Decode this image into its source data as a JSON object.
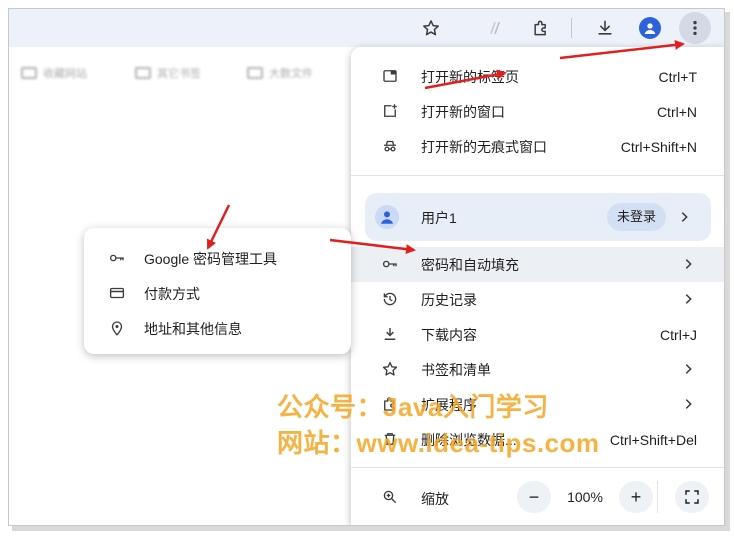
{
  "toolbar": {
    "icons": [
      "star-icon",
      "extension-a-icon",
      "puzzle-icon",
      "download-icon",
      "profile-icon",
      "more-vert-icon"
    ]
  },
  "bookmarks": {
    "items": [
      {
        "label": "收藏网站"
      },
      {
        "label": "其它书签"
      },
      {
        "label": "大数文件"
      }
    ]
  },
  "menu": {
    "new_tab": {
      "label": "打开新的标签页",
      "shortcut": "Ctrl+T"
    },
    "new_window": {
      "label": "打开新的窗口",
      "shortcut": "Ctrl+N"
    },
    "incognito": {
      "label": "打开新的无痕式窗口",
      "shortcut": "Ctrl+Shift+N"
    },
    "profile": {
      "name": "用户1",
      "status": "未登录"
    },
    "passwords": {
      "label": "密码和自动填充"
    },
    "history": {
      "label": "历史记录"
    },
    "downloads": {
      "label": "下载内容",
      "shortcut": "Ctrl+J"
    },
    "bookmarks": {
      "label": "书签和清单"
    },
    "extensions": {
      "label": "扩展程序"
    },
    "clear_data": {
      "label": "删除浏览数据...",
      "shortcut": "Ctrl+Shift+Del"
    },
    "zoom": {
      "label": "缩放",
      "minus": "−",
      "value": "100%",
      "plus": "+"
    }
  },
  "submenu": {
    "items": [
      {
        "label": "Google 密码管理工具"
      },
      {
        "label": "付款方式"
      },
      {
        "label": "地址和其他信息"
      }
    ]
  },
  "watermark": {
    "line1": "公众号：Java入门学习",
    "line2": "网站：www.idea-tips.com"
  },
  "colors": {
    "accent_blue": "#2d63d8",
    "arrow_red": "#e02020",
    "watermark_orange": "#f5a623"
  }
}
